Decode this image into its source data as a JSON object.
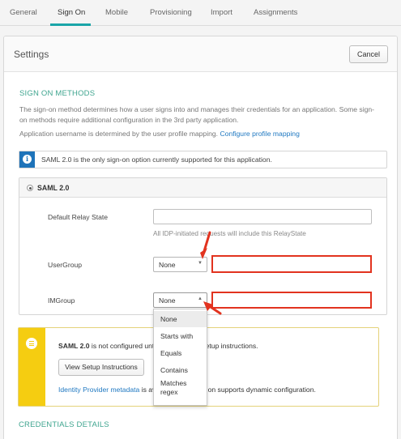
{
  "tabs": [
    {
      "label": "General",
      "active": false
    },
    {
      "label": "Sign On",
      "active": true
    },
    {
      "label": "Mobile",
      "active": false
    },
    {
      "label": "Provisioning",
      "active": false
    },
    {
      "label": "Import",
      "active": false
    },
    {
      "label": "Assignments",
      "active": false
    }
  ],
  "panel": {
    "title": "Settings",
    "cancel_label": "Cancel"
  },
  "sign_on": {
    "section_title": "SIGN ON METHODS",
    "description_line1": "The sign-on method determines how a user signs into and manages their credentials for an application. Some sign-",
    "description_line2": "on methods require additional configuration in the 3rd party application.",
    "username_text": "Application username is determined by the user profile mapping.",
    "username_link": "Configure profile mapping",
    "info_text": "SAML 2.0 is the only sign-on option currently supported for this application."
  },
  "saml": {
    "label": "SAML 2.0",
    "relay_state_label": "Default Relay State",
    "relay_state_value": "",
    "relay_state_hint": "All IDP-initiated requests will include this RelayState",
    "usergroup_label": "UserGroup",
    "usergroup_value": "None",
    "imgroup_label": "IMGroup",
    "imgroup_value": "None",
    "dropdown_options": [
      "None",
      "Starts with",
      "Equals",
      "Contains",
      "Matches",
      "regex"
    ]
  },
  "setup": {
    "text_bold": "SAML 2.0",
    "text_a": " is not configured unt",
    "text_b": "he setup instructions.",
    "button_label": "View Setup Instructions",
    "metadata_link": "Identity Provider metadata",
    "metadata_a": " is av",
    "metadata_b": "lication supports dynamic configuration."
  },
  "credentials": {
    "section_title": "CREDENTIALS DETAILS"
  },
  "colors": {
    "accent": "#1aa5a8",
    "section_title": "#3fa58f",
    "highlight_red": "#e2331f",
    "info_blue": "#1e73b9",
    "warning_yellow": "#f5cd11",
    "link": "#1f78c1"
  },
  "icons": {
    "info": "info-icon",
    "setup": "list-icon",
    "select_down": "triangle-down",
    "select_up": "triangle-up",
    "annotation": "red-arrow"
  }
}
